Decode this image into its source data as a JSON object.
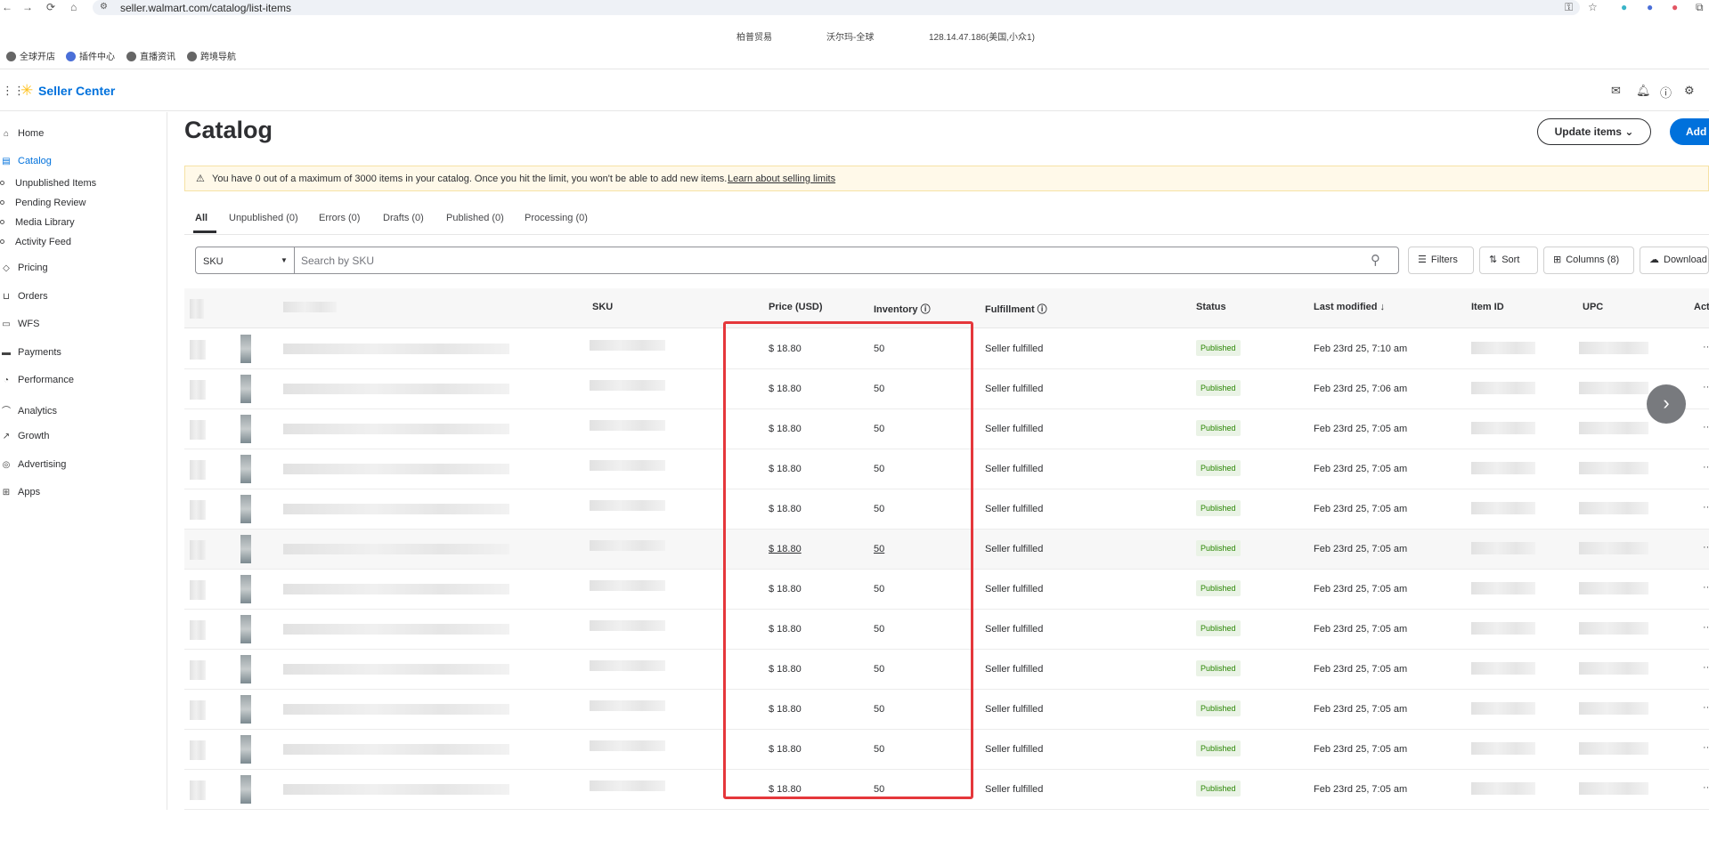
{
  "browser": {
    "url": "seller.walmart.com/catalog/list-items",
    "proxy": [
      "柏普贸易",
      "沃尔玛-全球",
      "128.14.47.186(美国,小众1)"
    ],
    "bookmarks": [
      "全球开店",
      "插件中心",
      "直播资讯",
      "跨境导航"
    ]
  },
  "header": {
    "logo": "Seller Center"
  },
  "sidebar": {
    "items": [
      {
        "label": "Home",
        "icon": "home-icon"
      },
      {
        "label": "Catalog",
        "icon": "catalog-icon",
        "active": true
      },
      {
        "label": "Unpublished Items",
        "sub": true
      },
      {
        "label": "Pending Review",
        "sub": true
      },
      {
        "label": "Media Library",
        "sub": true
      },
      {
        "label": "Activity Feed",
        "sub": true
      },
      {
        "label": "Pricing",
        "icon": "tag-icon"
      },
      {
        "label": "Orders",
        "icon": "cart-icon"
      },
      {
        "label": "WFS",
        "icon": "truck-icon"
      },
      {
        "label": "Payments",
        "icon": "payment-icon"
      },
      {
        "label": "Performance",
        "icon": "gauge-icon"
      },
      {
        "label": "Analytics",
        "icon": "chart-icon"
      },
      {
        "label": "Growth",
        "icon": "rocket-icon"
      },
      {
        "label": "Advertising",
        "icon": "target-icon"
      },
      {
        "label": "Apps",
        "icon": "apps-icon"
      }
    ]
  },
  "main": {
    "title": "Catalog",
    "update_btn": "Update items",
    "add_btn": "Add",
    "banner": {
      "message": "You have 0 out of a maximum of 3000 items in your catalog. Once you hit the limit, you won't be able to add new items.",
      "link": "Learn about selling limits"
    },
    "tabs": [
      "All",
      "Unpublished (0)",
      "Errors (0)",
      "Drafts (0)",
      "Published (0)",
      "Processing (0)"
    ],
    "search": {
      "selector": "SKU",
      "placeholder": "Search by SKU"
    },
    "tools": {
      "filters": "Filters",
      "sort": "Sort",
      "columns": "Columns (8)",
      "download": "Download"
    },
    "columns": [
      "SKU",
      "Price (USD)",
      "Inventory",
      "Fulfillment",
      "Status",
      "Last modified ↓",
      "Item ID",
      "UPC",
      "Act"
    ],
    "rows": [
      {
        "price": "$ 18.80",
        "inventory": "50",
        "fulfillment": "Seller fulfilled",
        "status": "Published",
        "modified": "Feb 23rd 25, 7:10 am"
      },
      {
        "price": "$ 18.80",
        "inventory": "50",
        "fulfillment": "Seller fulfilled",
        "status": "Published",
        "modified": "Feb 23rd 25, 7:06 am"
      },
      {
        "price": "$ 18.80",
        "inventory": "50",
        "fulfillment": "Seller fulfilled",
        "status": "Published",
        "modified": "Feb 23rd 25, 7:05 am"
      },
      {
        "price": "$ 18.80",
        "inventory": "50",
        "fulfillment": "Seller fulfilled",
        "status": "Published",
        "modified": "Feb 23rd 25, 7:05 am"
      },
      {
        "price": "$ 18.80",
        "inventory": "50",
        "fulfillment": "Seller fulfilled",
        "status": "Published",
        "modified": "Feb 23rd 25, 7:05 am"
      },
      {
        "price": "$ 18.80",
        "inventory": "50",
        "fulfillment": "Seller fulfilled",
        "status": "Published",
        "modified": "Feb 23rd 25, 7:05 am",
        "hover": true
      },
      {
        "price": "$ 18.80",
        "inventory": "50",
        "fulfillment": "Seller fulfilled",
        "status": "Published",
        "modified": "Feb 23rd 25, 7:05 am"
      },
      {
        "price": "$ 18.80",
        "inventory": "50",
        "fulfillment": "Seller fulfilled",
        "status": "Published",
        "modified": "Feb 23rd 25, 7:05 am"
      },
      {
        "price": "$ 18.80",
        "inventory": "50",
        "fulfillment": "Seller fulfilled",
        "status": "Published",
        "modified": "Feb 23rd 25, 7:05 am"
      },
      {
        "price": "$ 18.80",
        "inventory": "50",
        "fulfillment": "Seller fulfilled",
        "status": "Published",
        "modified": "Feb 23rd 25, 7:05 am"
      },
      {
        "price": "$ 18.80",
        "inventory": "50",
        "fulfillment": "Seller fulfilled",
        "status": "Published",
        "modified": "Feb 23rd 25, 7:05 am"
      },
      {
        "price": "$ 18.80",
        "inventory": "50",
        "fulfillment": "Seller fulfilled",
        "status": "Published",
        "modified": "Feb 23rd 25, 7:05 am"
      }
    ]
  },
  "colors": {
    "brand": "#0071dc",
    "spark": "#ffc220",
    "highlight_box": "#e5373b",
    "published": "#2a8703"
  }
}
